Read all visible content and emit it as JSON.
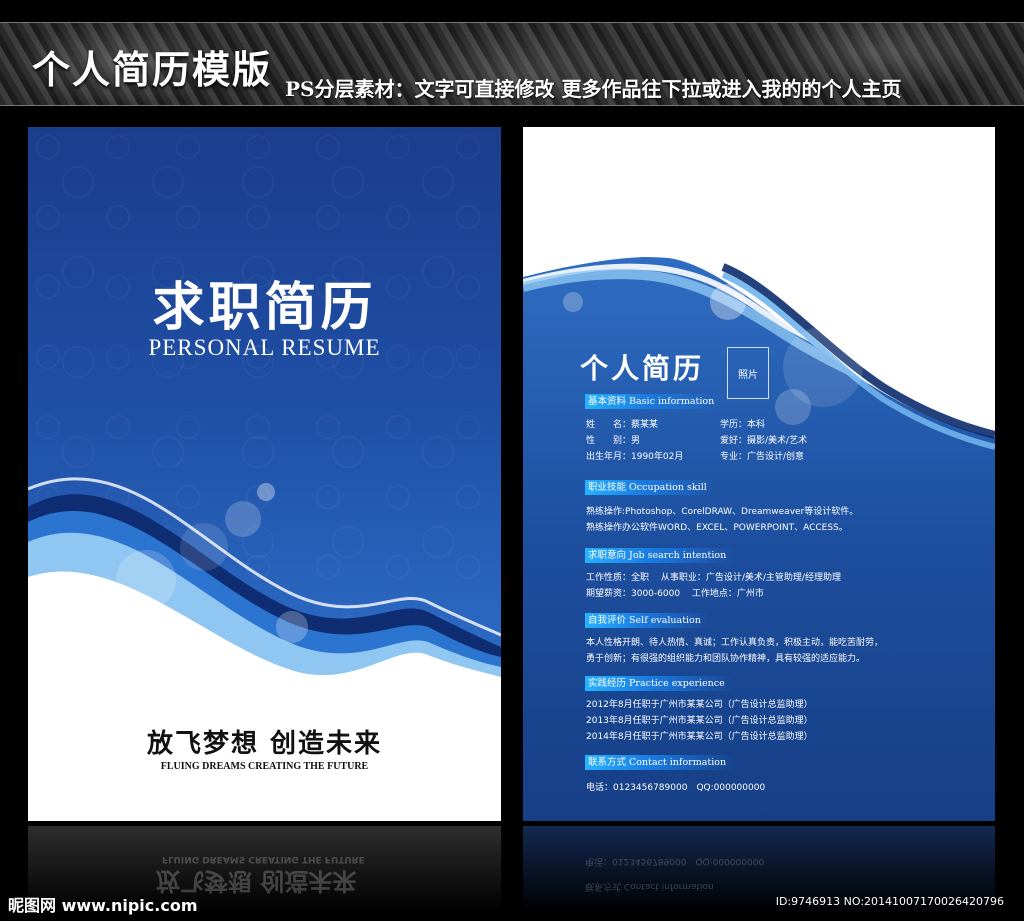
{
  "banner": {
    "title": "个人简历模版",
    "subtitle": "PS分层素材：文字可直接修改 更多作品往下拉或进入我的的个人主页"
  },
  "cover": {
    "title": "求职简历",
    "subtitle": "PERSONAL RESUME",
    "slogan": "放飞梦想 创造未来",
    "slogan_en": "FLUING DREAMS CREATING THE FUTURE"
  },
  "resume": {
    "title": "个人简历",
    "photo": "照片",
    "basic": {
      "heading": "基本资料 Basic information",
      "name": "姓　　名：蔡某某",
      "gender": "性　　别：男",
      "birth": "出生年月：1990年02月",
      "education": "学历：本科",
      "hobby": "爱好：摄影/美术/艺术",
      "major": "专业：广告设计/创意"
    },
    "skill": {
      "heading": "职业技能 Occupation skill",
      "line1": "熟练操作:Photoshop、CorelDRAW、Dreamweaver等设计软件。",
      "line2": "熟练操作办公软件WORD、EXCEL、POWERPOINT、ACCESS。"
    },
    "intent": {
      "heading": "求职意向 Job search intention",
      "line1": "工作性质：全职　 从事职业：广告设计/美术/主管助理/经理助理",
      "line2": "期望薪资：3000-6000　 工作地点：广州市"
    },
    "self": {
      "heading": "自我评价 Self evaluation",
      "line1": "本人性格开朗、待人热情、真诚；工作认真负责，积极主动，能吃苦耐劳，",
      "line2": "勇于创新；有很强的组织能力和团队协作精神，具有较强的适应能力。"
    },
    "practice": {
      "heading": "实践经历 Practice experience",
      "line1": "2012年8月任职于广州市某某公司（广告设计总监助理）",
      "line2": "2013年8月任职于广州市某某公司（广告设计总监助理）",
      "line3": "2014年8月任职于广州市某某公司（广告设计总监助理）"
    },
    "contact": {
      "heading": "联系方式 Contact information",
      "line1": "电话：0123456789000　QQ:000000000"
    }
  },
  "watermark": {
    "left": "昵图网 www.nipic.com",
    "right": "ID:9746913 NO:20141007170026420796"
  },
  "colors": {
    "cover_blue": "#1f4fa5",
    "accent": "#27b2ff"
  }
}
